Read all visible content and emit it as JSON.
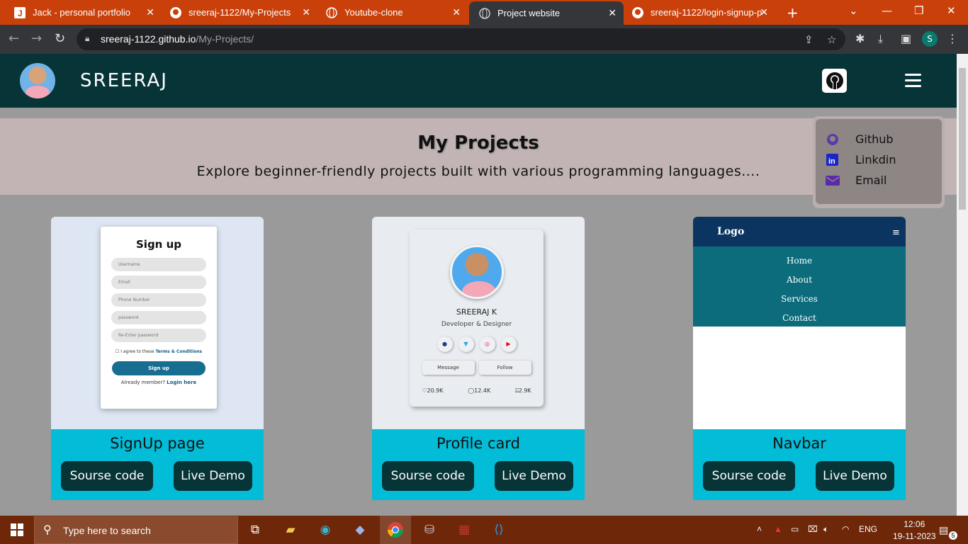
{
  "browser": {
    "tabs": [
      {
        "title": "Jack - personal portfolio",
        "icon": "j-logo-icon"
      },
      {
        "title": "sreeraj-1122/My-Projects",
        "icon": "github-icon"
      },
      {
        "title": "Youtube-clone",
        "icon": "globe-icon"
      },
      {
        "title": "Project website",
        "icon": "globe-icon"
      },
      {
        "title": "sreeraj-1122/login-signup-p",
        "icon": "github-icon"
      }
    ],
    "url_host": "sreeraj-1122.github.io",
    "url_path": "/My-Projects/",
    "profile_initial": "S"
  },
  "site": {
    "name": "SREERAJ",
    "hero_title": "My Projects",
    "hero_subtitle": "Explore beginner-friendly projects built with various programming languages....",
    "dropdown": [
      {
        "label": "Github",
        "icon": "github-icon"
      },
      {
        "label": "Linkdin",
        "icon": "linkedin-icon"
      },
      {
        "label": "Email",
        "icon": "email-icon"
      }
    ]
  },
  "cards": [
    {
      "title": "SignUp page",
      "source_label": "Sourse code",
      "demo_label": "Live Demo"
    },
    {
      "title": "Profile card",
      "source_label": "Sourse code",
      "demo_label": "Live Demo"
    },
    {
      "title": "Navbar",
      "source_label": "Sourse code",
      "demo_label": "Live Demo"
    }
  ],
  "signup_preview": {
    "heading": "Sign up",
    "fields": [
      "Username",
      "Email",
      "Phone Number",
      "password",
      "Re-Enter password"
    ],
    "agree_prefix": "I agree to these",
    "agree_link": "Terms & Conditions",
    "button": "Sign up",
    "login_prefix": "Already member?",
    "login_link": "Login here"
  },
  "profile_preview": {
    "name": "SREERAJ K",
    "role": "Developer & Designer",
    "message": "Message",
    "follow": "Follow",
    "likes": "♡20.9K",
    "comments": "◯12.4K",
    "shares": "⍓2.9K"
  },
  "navbar_preview": {
    "logo": "Logo",
    "links": [
      "Home",
      "About",
      "Services",
      "Contact"
    ]
  },
  "taskbar": {
    "search_placeholder": "Type here to search",
    "lang": "ENG",
    "time": "12:06",
    "date": "19-11-2023",
    "notifications": "5"
  },
  "colors": {
    "tab_strip": "#c9400b",
    "site_header": "#073537",
    "card_footer": "#03bcd7",
    "taskbar": "#6e2709"
  }
}
